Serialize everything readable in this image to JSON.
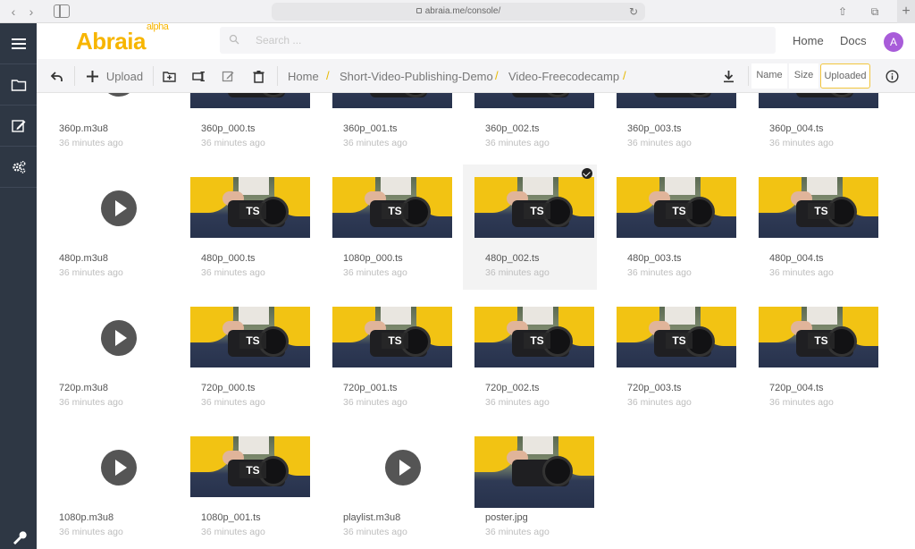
{
  "browser": {
    "url": "abraia.me/console/"
  },
  "header": {
    "logo": "Abraia",
    "logo_sup": "alpha",
    "search_placeholder": "Search ...",
    "nav": [
      "Home",
      "Docs"
    ],
    "avatar_letter": "A",
    "avatar_color": "#a85cd9"
  },
  "toolbar": {
    "upload_label": "Upload",
    "breadcrumbs": [
      "Home",
      "Short-Video-Publishing-Demo",
      "Video-Freecodecamp"
    ],
    "sort": [
      "Name",
      "Size",
      "Uploaded"
    ],
    "active_sort": "Uploaded"
  },
  "colors": {
    "accent": "#f7b500",
    "rail": "#2e3744"
  },
  "files": [
    {
      "name": "360p.m3u8",
      "time": "36 minutes ago",
      "kind": "playlist"
    },
    {
      "name": "360p_000.ts",
      "time": "36 minutes ago",
      "kind": "ts"
    },
    {
      "name": "360p_001.ts",
      "time": "36 minutes ago",
      "kind": "ts"
    },
    {
      "name": "360p_002.ts",
      "time": "36 minutes ago",
      "kind": "ts"
    },
    {
      "name": "360p_003.ts",
      "time": "36 minutes ago",
      "kind": "ts"
    },
    {
      "name": "360p_004.ts",
      "time": "36 minutes ago",
      "kind": "ts"
    },
    {
      "name": "480p.m3u8",
      "time": "36 minutes ago",
      "kind": "playlist"
    },
    {
      "name": "480p_000.ts",
      "time": "36 minutes ago",
      "kind": "ts"
    },
    {
      "name": "1080p_000.ts",
      "time": "36 minutes ago",
      "kind": "ts"
    },
    {
      "name": "480p_002.ts",
      "time": "36 minutes ago",
      "kind": "ts",
      "selected": true
    },
    {
      "name": "480p_003.ts",
      "time": "36 minutes ago",
      "kind": "ts"
    },
    {
      "name": "480p_004.ts",
      "time": "36 minutes ago",
      "kind": "ts"
    },
    {
      "name": "720p.m3u8",
      "time": "36 minutes ago",
      "kind": "playlist"
    },
    {
      "name": "720p_000.ts",
      "time": "36 minutes ago",
      "kind": "ts"
    },
    {
      "name": "720p_001.ts",
      "time": "36 minutes ago",
      "kind": "ts"
    },
    {
      "name": "720p_002.ts",
      "time": "36 minutes ago",
      "kind": "ts"
    },
    {
      "name": "720p_003.ts",
      "time": "36 minutes ago",
      "kind": "ts"
    },
    {
      "name": "720p_004.ts",
      "time": "36 minutes ago",
      "kind": "ts"
    },
    {
      "name": "1080p.m3u8",
      "time": "36 minutes ago",
      "kind": "playlist"
    },
    {
      "name": "1080p_001.ts",
      "time": "36 minutes ago",
      "kind": "ts"
    },
    {
      "name": "playlist.m3u8",
      "time": "36 minutes ago",
      "kind": "playlist"
    },
    {
      "name": "poster.jpg",
      "time": "36 minutes ago",
      "kind": "image"
    }
  ],
  "ts_badge": "TS"
}
